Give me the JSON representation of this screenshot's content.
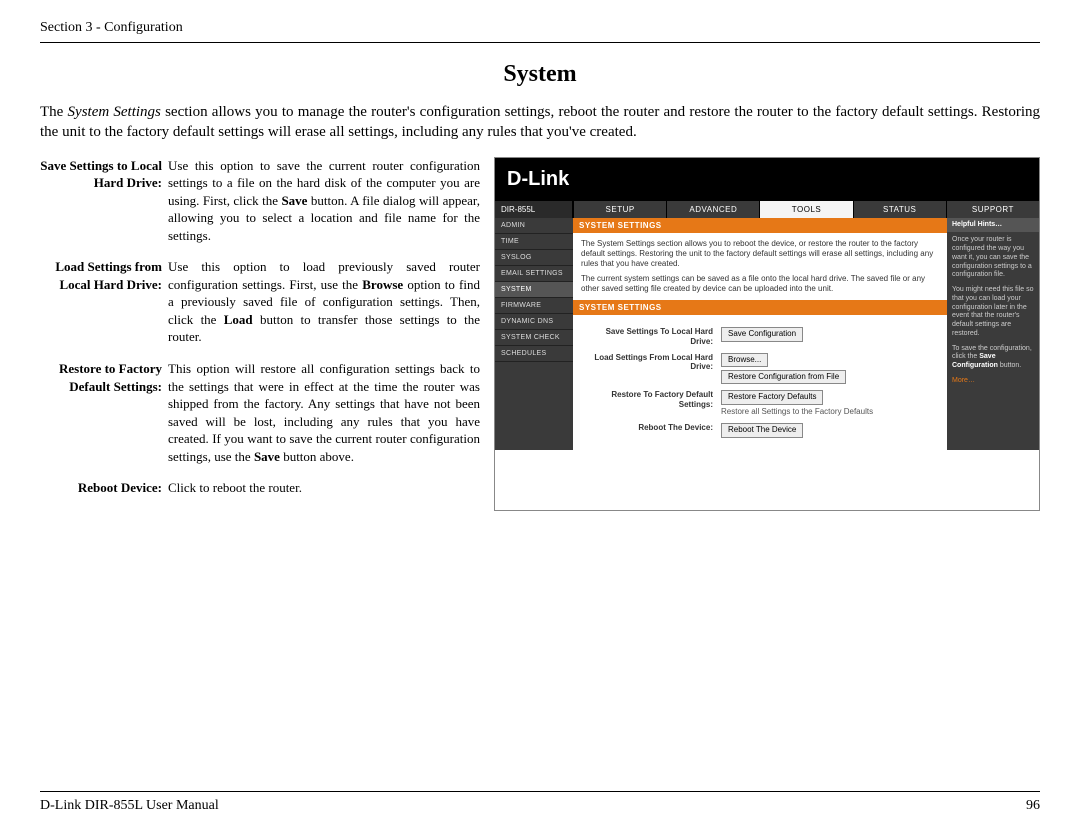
{
  "header": {
    "section": "Section 3 - Configuration"
  },
  "title": "System",
  "intro": {
    "lead": "The ",
    "em": "System Settings",
    "rest": " section allows you to manage the router's configuration settings, reboot the router and restore the router to the factory default settings. Restoring the unit to the factory default settings will erase all settings, including any rules that you've created."
  },
  "defs": [
    {
      "term": "Save Settings to Local Hard Drive:",
      "desc_parts": [
        "Use this option to save the current router configuration settings to a file on the hard disk of the computer you are using. First, click the ",
        {
          "b": "Save"
        },
        " button. A file dialog will appear, allowing you to select a location and file name for the settings."
      ]
    },
    {
      "term": "Load Settings from Local Hard Drive:",
      "desc_parts": [
        "Use this option to load previously saved router configuration settings. First, use the ",
        {
          "b": "Browse"
        },
        " option to find a previously saved file of configuration settings. Then, click the ",
        {
          "b": "Load"
        },
        " button to transfer those settings to the router."
      ]
    },
    {
      "term": "Restore to Factory Default Settings:",
      "desc_parts": [
        "This option will restore all configuration settings back to the settings that were in effect at the time the router was shipped from the factory. Any settings that have not been saved will be lost, including any rules that you have created. If you want to save the current router configuration settings, use the ",
        {
          "b": "Save"
        },
        " button above."
      ]
    },
    {
      "term": "Reboot Device:",
      "desc_parts": [
        "Click to reboot the router."
      ]
    }
  ],
  "router": {
    "brand": "D-Link",
    "model": "DIR-855L",
    "tabs": [
      "SETUP",
      "ADVANCED",
      "TOOLS",
      "STATUS",
      "SUPPORT"
    ],
    "active_tab": "TOOLS",
    "sidebar": [
      "ADMIN",
      "TIME",
      "SYSLOG",
      "EMAIL SETTINGS",
      "SYSTEM",
      "FIRMWARE",
      "DYNAMIC DNS",
      "SYSTEM CHECK",
      "SCHEDULES"
    ],
    "sidebar_selected": "SYSTEM",
    "section1": {
      "title": "SYSTEM SETTINGS",
      "p1": "The System Settings section allows you to reboot the device, or restore the router to the factory default settings. Restoring the unit to the factory default settings will erase all settings, including any rules that you have created.",
      "p2": "The current system settings can be saved as a file onto the local hard drive. The saved file or any other saved setting file created by device can be uploaded into the unit."
    },
    "section2": {
      "title": "SYSTEM SETTINGS",
      "rows": [
        {
          "label": "Save Settings To Local Hard Drive:",
          "button": "Save Configuration"
        },
        {
          "label": "Load Settings From Local Hard Drive:",
          "button": "Browse...",
          "button2": "Restore Configuration from File"
        },
        {
          "label": "Restore To Factory Default Settings:",
          "button": "Restore Factory Defaults",
          "note": "Restore all Settings to the Factory Defaults"
        },
        {
          "label": "Reboot The Device:",
          "button": "Reboot The Device"
        }
      ]
    },
    "hints": {
      "title": "Helpful Hints…",
      "p1": "Once your router is configured the way you want it, you can save the configuration settings to a configuration file.",
      "p2": "You might need this file so that you can load your configuration later in the event that the router's default settings are restored.",
      "p3_lead": "To save the configuration, click the ",
      "p3_bold": "Save Configuration",
      "p3_tail": " button.",
      "more": "More…"
    }
  },
  "footer": {
    "left": "D-Link DIR-855L User Manual",
    "right": "96"
  }
}
